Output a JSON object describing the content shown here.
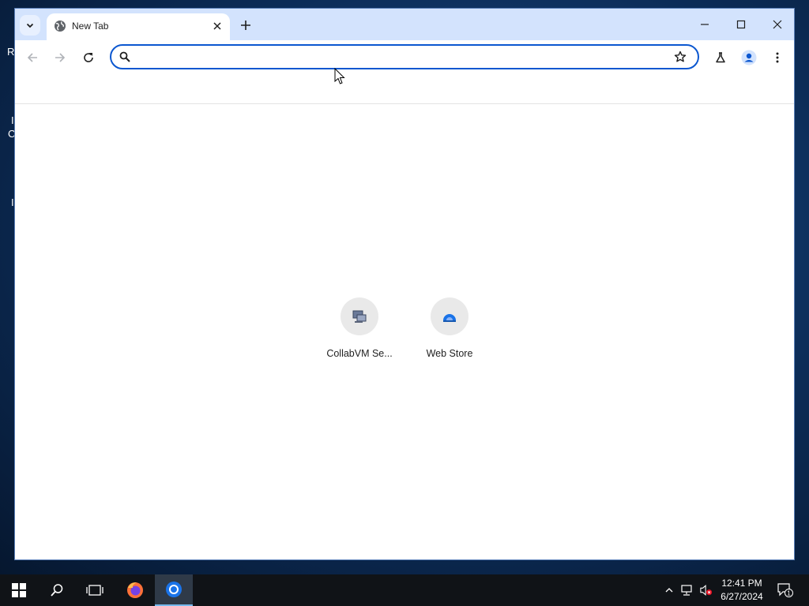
{
  "desktop": {
    "edge_glyphs": [
      "R",
      "I",
      "C",
      "I"
    ]
  },
  "browser": {
    "tab": {
      "title": "New Tab",
      "favicon": "globe-icon"
    },
    "toolbar": {
      "address_value": "",
      "address_placeholder": ""
    },
    "icons": {
      "tab_search": "chevron-down-icon",
      "new_tab": "plus-icon",
      "minimize": "minimize-icon",
      "maximize": "maximize-icon",
      "close": "close-icon",
      "back": "back-arrow-icon",
      "forward": "forward-arrow-icon",
      "reload": "reload-icon",
      "bookmark": "star-icon",
      "labs": "flask-icon",
      "profile": "profile-icon",
      "menu": "kebab-menu-icon"
    },
    "shortcuts": [
      {
        "label": "CollabVM Se...",
        "icon": "collabvm-icon"
      },
      {
        "label": "Web Store",
        "icon": "web-store-icon"
      }
    ],
    "colors": {
      "tabstrip": "#d3e3fd",
      "accent": "#0b57d0"
    }
  },
  "taskbar": {
    "clock": {
      "time": "12:41 PM",
      "date": "6/27/2024"
    },
    "notification_count": "1",
    "apps": [
      "start-icon",
      "search-icon",
      "task-view-icon",
      "firefox-icon",
      "chrome-icon"
    ]
  }
}
